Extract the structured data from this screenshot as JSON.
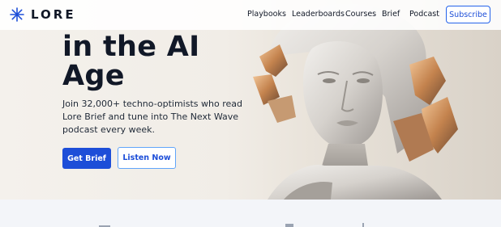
{
  "brand": {
    "name": "LORE",
    "icon": "asterisk-star-icon",
    "color": "#1d4ed8"
  },
  "nav": {
    "items": [
      {
        "label": "Playbooks"
      },
      {
        "label": "Leaderboards"
      },
      {
        "label": "Courses"
      },
      {
        "label": "Brief"
      },
      {
        "label": "Podcast"
      }
    ],
    "subscribe_label": "Subscribe"
  },
  "hero": {
    "headline_line_1": "in the AI",
    "headline_line_2": "Age",
    "subtext": "Join 32,000+ techno-optimists who read Lore Brief and tune into The Next Wave podcast every week.",
    "primary_button": "Get Brief",
    "secondary_button": "Listen Now"
  },
  "colors": {
    "accent": "#1d4ed8",
    "text": "#111827",
    "hero_bg": "#f1ede7",
    "lower_bg": "#f3f5f9"
  }
}
